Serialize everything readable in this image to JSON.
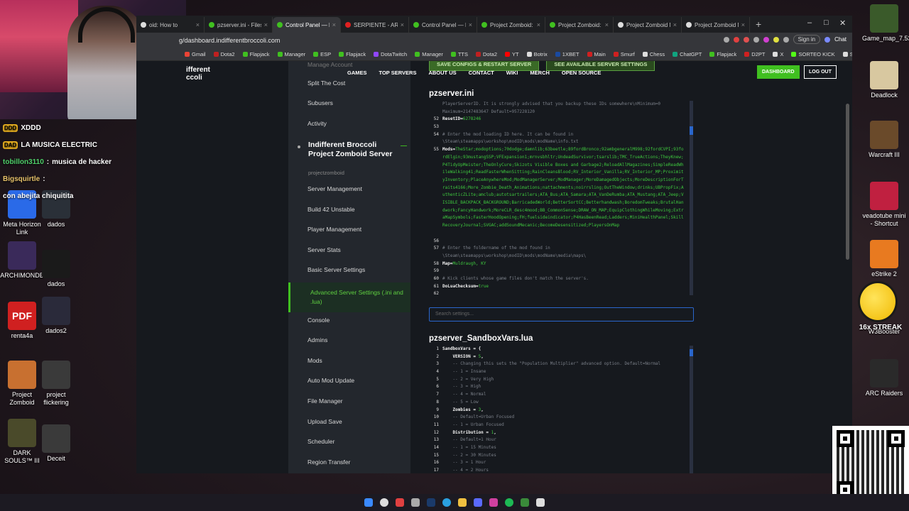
{
  "chat": [
    {
      "user": "",
      "msg": "XDDD",
      "badge": "DDD"
    },
    {
      "user": "",
      "msg": "LA MUSICA ELECTRIC",
      "badge": "DAD"
    },
    {
      "user": "tobillon3110",
      "msg": "musica de hacker"
    },
    {
      "user": "Bigsquirtle",
      "msg": ":"
    },
    {
      "user": "",
      "msg": "con abejita chiquitita"
    }
  ],
  "desktop_left": [
    {
      "label": "Meta Horizon Link",
      "color": "#2a6ae8"
    },
    {
      "label": "dados",
      "color": "#2a3038"
    },
    {
      "label": "ARCHIMONDE",
      "color": "#3a2a5a"
    },
    {
      "label": "dados",
      "color": "#1a1a1a"
    },
    {
      "label": "renta4a",
      "color": "#d02020",
      "glyph": "PDF"
    },
    {
      "label": "dados2",
      "color": "#2a2a3a"
    },
    {
      "label": "Project Zomboid",
      "color": "#c87030"
    },
    {
      "label": "project flickering",
      "color": "#3a3a3a"
    },
    {
      "label": "DARK SOULS™ III",
      "color": "#4a4a2a"
    },
    {
      "label": "Deceit",
      "color": "#3a3a3a"
    }
  ],
  "desktop_right": [
    {
      "label": "Game_map_7.53",
      "color": "#3a5a2a"
    },
    {
      "label": "Deadlock",
      "color": "#d8c8a0"
    },
    {
      "label": "Warcraft III",
      "color": "#6a4a2a"
    },
    {
      "label": "veadotube mini - Shortcut",
      "color": "#c02040"
    },
    {
      "label": "eStrike 2",
      "color": "#e87a20"
    },
    {
      "label": "W3Booster",
      "color": "#f0c020"
    },
    {
      "label": "ARC Raiders",
      "color": "#2a2a2a"
    }
  ],
  "browser": {
    "tabs": [
      {
        "label": "oid: How to",
        "color": "#ddd",
        "active": false
      },
      {
        "label": "pzserver.ini - Files - Indiff",
        "color": "#40c020",
        "active": false
      },
      {
        "label": "Control Panel — Indifferen",
        "color": "#40c020",
        "active": true
      },
      {
        "label": "SERPIENTE - ARMON",
        "color": "#e02020",
        "active": false
      },
      {
        "label": "Control Panel — Indifferen",
        "color": "#40c020",
        "active": false
      },
      {
        "label": "Project Zomboid: How to",
        "color": "#40c020",
        "active": false
      },
      {
        "label": "Project Zomboid: How to",
        "color": "#40c020",
        "active": false
      },
      {
        "label": "Project Zomboid Mod Id",
        "color": "#ddd",
        "active": false
      },
      {
        "label": "Project Zomboid Mod Id",
        "color": "#ddd",
        "active": false
      }
    ],
    "url": "g/dashboard.indifferentbroccoli.com",
    "signin": "Sign in",
    "chat": "Chat",
    "bookmarks": [
      {
        "label": "Gmail",
        "color": "#ea4335"
      },
      {
        "label": "Dota2",
        "color": "#c02020"
      },
      {
        "label": "Flapjack",
        "color": "#40c020"
      },
      {
        "label": "Manager",
        "color": "#40c020"
      },
      {
        "label": "ESP",
        "color": "#40c020"
      },
      {
        "label": "Flapjack",
        "color": "#40c020"
      },
      {
        "label": "DotaTwitch",
        "color": "#9146ff"
      },
      {
        "label": "Manager",
        "color": "#40c020"
      },
      {
        "label": "TTS",
        "color": "#40c020"
      },
      {
        "label": "Dota2",
        "color": "#c02020"
      },
      {
        "label": "YT",
        "color": "#ff0000"
      },
      {
        "label": "Botrix",
        "color": "#ddd"
      },
      {
        "label": "1XBET",
        "color": "#1a4aa0"
      },
      {
        "label": "Main",
        "color": "#d02020"
      },
      {
        "label": "Smurf",
        "color": "#d02020"
      },
      {
        "label": "Chess",
        "color": "#ddd"
      },
      {
        "label": "ChatGPT",
        "color": "#10a37f"
      },
      {
        "label": "Flapjack",
        "color": "#40c020"
      },
      {
        "label": "D2PT",
        "color": "#d02020"
      },
      {
        "label": "X",
        "color": "#ddd"
      },
      {
        "label": "SORTEO KICK",
        "color": "#53fc18"
      },
      {
        "label": "STEAM ID",
        "color": "#ddd"
      }
    ]
  },
  "site": {
    "logo_line1": "ifferent",
    "logo_line2": "ccoli",
    "nav": [
      "GAMES",
      "TOP SERVERS",
      "ABOUT US",
      "CONTACT",
      "WIKI",
      "MERCH",
      "OPEN SOURCE"
    ],
    "btn_save": "SAVE CONFIGS & RESTART SERVER",
    "btn_see": "SEE AVAILABLE SERVER SETTINGS",
    "dashboard": "DASHBOARD",
    "logout": "LOG OUT"
  },
  "sidebar": {
    "top": [
      "Manage Account",
      "Split The Cost",
      "Subusers",
      "Activity"
    ],
    "server_name": "Indifferent Broccoli Project Zomboid Server",
    "server_sub": "projectzomboid",
    "items": [
      "Server Management",
      "Build 42 Unstable",
      "Player Management",
      "Server Stats",
      "Basic Server Settings",
      "Advanced Server Settings (.ini and .lua)",
      "Console",
      "Admins",
      "Mods",
      "Auto Mod Update",
      "File Manager",
      "Upload Save",
      "Scheduler",
      "Region Transfer"
    ],
    "active_index": 5
  },
  "editor1": {
    "title": "pzserver.ini",
    "lines": [
      {
        "n": "",
        "t": "com",
        "c": "PlayerServerID. It is strongly advised that you backup these IDs somewhere\\nMinimum=0"
      },
      {
        "n": "",
        "t": "com",
        "c": "Maximum=2147483647 Default=957228120"
      },
      {
        "n": "52",
        "k": "ResetID",
        "v": "6278246"
      },
      {
        "n": "53",
        "t": "plain",
        "c": ""
      },
      {
        "n": "54",
        "t": "com",
        "c": "# Enter the mod loading ID here. It can be found in"
      },
      {
        "n": "",
        "t": "com",
        "c": "\\Steam\\steamapps\\workshop\\modID\\mods\\modName\\info.txt"
      },
      {
        "n": "55",
        "k": "Mods",
        "wrap": true,
        "v": "TheStar;modoptions;70dodge;damnlib;63beetle;89fordBronco;92ambgeneralM998;92fordCVPI;93fordElgin;93mustangSSP;VFExpansion1;mrnvsbhltr;UndeadSurvivor;tsarslib;TMC_TrueActions;TheyKnew;P4TidyUpMeister;TheOnlyCure;Skizots Visible Boxes and Garbage2;ReloadAllMagazines;SimpleReadWhileWalking41;ReadFasterWhenSitting;RainCleansBlood;RV_Interior_Vanilla;RV_Interior_MP;ProximityInventory;PlaceAnywhereMod;ModManagerServer;ModManager;MoreDamagedObjects;MoreDescriptionForTraits4166;More_Zombie_Death_Animations;nattachments;noirrsling;OutTheWindow;drinks;UBPropFix;AuthenticZLite;amclub;autotsartrailers;ATA_Bus;ATA_Samara;ATA_VanDeRumba;ATA_Mustang;ATA_Jeep;VISIBLE_BACKPACK_BACKGROUND;BarricadedWorld;BetterSortCC;Betterhandwash;BoredomTweaks;BrutalHandwork;FancyHandwork;MoreCLR_desc4mood;BB_CommonSense;DRAW_ON_MAP;EquipClothingWhileMoving;ExtraMapSymbols;FasterHoodOpening;FH;fuelsideindicator;P4HasBeenRead;Ladders;MiniHealthPanel;SkillRecoveryJournal;SVGAC;addSoundMecanic;BecomeDesensitized;PlayersOnMap"
      },
      {
        "n": "56",
        "t": "plain",
        "c": ""
      },
      {
        "n": "57",
        "t": "com",
        "c": "# Enter the foldername of the mod found in"
      },
      {
        "n": "",
        "t": "com",
        "c": "\\Steam\\steamapps\\workshop\\modID\\mods\\modName\\media\\maps\\"
      },
      {
        "n": "58",
        "k": "Map",
        "v": "Muldraugh, KY"
      },
      {
        "n": "59",
        "t": "plain",
        "c": ""
      },
      {
        "n": "60",
        "t": "com",
        "c": "# Kick clients whose game files don't match the server's."
      },
      {
        "n": "61",
        "k": "DoLuaChecksum",
        "v": "true"
      },
      {
        "n": "62",
        "t": "plain",
        "c": ""
      }
    ]
  },
  "search_placeholder": "Search settings...",
  "editor2": {
    "title": "pzserver_SandboxVars.lua",
    "lines": [
      {
        "n": "1",
        "t": "key",
        "c": "SandboxVars = {"
      },
      {
        "n": "2",
        "t": "kv",
        "k": "    VERSION = ",
        "v": "5",
        "e": ","
      },
      {
        "n": "3",
        "t": "com",
        "c": "    -- Changing this sets the \"Population Multiplier\" advanced option. Default=Normal"
      },
      {
        "n": "4",
        "t": "com",
        "c": "    -- 1 = Insane"
      },
      {
        "n": "5",
        "t": "com",
        "c": "    -- 2 = Very High"
      },
      {
        "n": "6",
        "t": "com",
        "c": "    -- 3 = High"
      },
      {
        "n": "7",
        "t": "com",
        "c": "    -- 4 = Normal"
      },
      {
        "n": "8",
        "t": "com",
        "c": "    -- 5 = Low"
      },
      {
        "n": "9",
        "t": "kv",
        "k": "    Zombies = ",
        "v": "3",
        "e": ","
      },
      {
        "n": "10",
        "t": "com",
        "c": "    -- Default=Urban Focused"
      },
      {
        "n": "11",
        "t": "com",
        "c": "    -- 1 = Urban Focused"
      },
      {
        "n": "12",
        "t": "kv",
        "k": "    Distribution = ",
        "v": "1",
        "e": ","
      },
      {
        "n": "13",
        "t": "com",
        "c": "    -- Default=1 Hour"
      },
      {
        "n": "14",
        "t": "com",
        "c": "    -- 1 = 15 Minutes"
      },
      {
        "n": "15",
        "t": "com",
        "c": "    -- 2 = 30 Minutes"
      },
      {
        "n": "16",
        "t": "com",
        "c": "    -- 3 = 1 Hour"
      },
      {
        "n": "17",
        "t": "com",
        "c": "    -- 4 = 2 Hours"
      }
    ]
  },
  "streak": "16x STREAK"
}
